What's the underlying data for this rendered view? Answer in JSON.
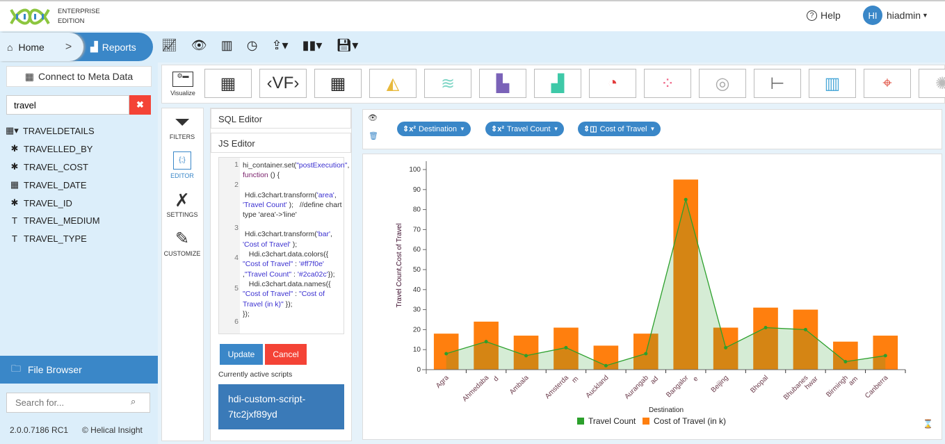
{
  "header": {
    "edition_line1": "ENTERPRISE",
    "edition_line2": "EDITION",
    "help": "Help",
    "avatar_initials": "HI",
    "username": "hiadmin"
  },
  "nav": {
    "home": "Home",
    "reports": "Reports",
    "toolbar_icons": [
      "line-chart-icon",
      "preview-icon",
      "presentation-icon",
      "history-icon",
      "share-icon",
      "layout-icon",
      "save-icon"
    ]
  },
  "sidebar": {
    "connect_label": "Connect to Meta Data",
    "search_value": "travel",
    "table": "TRAVELDETAILS",
    "fields": [
      {
        "label": "TRAVELLED_BY",
        "icon": "measure-icon"
      },
      {
        "label": "TRAVEL_COST",
        "icon": "measure-icon"
      },
      {
        "label": "TRAVEL_DATE",
        "icon": "calendar-icon"
      },
      {
        "label": "TRAVEL_ID",
        "icon": "measure-icon"
      },
      {
        "label": "TRAVEL_MEDIUM",
        "icon": "text-icon"
      },
      {
        "label": "TRAVEL_TYPE",
        "icon": "text-icon"
      }
    ],
    "file_browser": "File Browser",
    "file_search_placeholder": "Search for...",
    "version": "2.0.0.7186 RC1",
    "copyright": "© Helical Insight"
  },
  "visualize": {
    "label": "Visualize"
  },
  "tools": {
    "filters": "FILTERS",
    "editor": "EDITOR",
    "settings": "SETTINGS",
    "customize": "CUSTOMIZE"
  },
  "editor": {
    "sql_title": "SQL Editor",
    "js_title": "JS Editor",
    "update": "Update",
    "cancel": "Cancel",
    "active_scripts_label": "Currently active scripts",
    "active_script": "hdi-custom-script-7tc2jxf89yd"
  },
  "chips": [
    "Destination",
    "Travel Count",
    "Cost of Travel"
  ],
  "colors": {
    "accent": "#3a87c8",
    "cost": "#ff7f0e",
    "count": "#2ca02c",
    "cancel": "#f44336"
  },
  "chart_data": {
    "type": "bar+area",
    "categories": [
      "Agra",
      "Ahmedabad",
      "Ambala",
      "Amsterdam",
      "Auckland",
      "Aurangabad",
      "Bangalore",
      "Beijing",
      "Bhopal",
      "Bhubaneswar",
      "Birmingham",
      "Canberra"
    ],
    "tick_labels": [
      "Agra",
      "Ahmedaba d",
      "Ambala",
      "Amsterda m",
      "Auckland",
      "Aurangab ad",
      "Bangalor e",
      "Beijing",
      "Bhopal",
      "Bhubanes hwar",
      "Birmingh am",
      "Canberra"
    ],
    "series": [
      {
        "name": "Travel Count",
        "type": "area",
        "color": "#2ca02c",
        "values": [
          8,
          14,
          7,
          11,
          2,
          8,
          85,
          11,
          21,
          20,
          4,
          7
        ]
      },
      {
        "name": "Cost of Travel (in k)",
        "type": "bar",
        "color": "#ff7f0e",
        "values": [
          18,
          24,
          17,
          21,
          12,
          18,
          95,
          21,
          31,
          30,
          14,
          17
        ]
      }
    ],
    "xlabel": "Destination",
    "ylabel": "Travel Count,Cost of Travel",
    "ylim": [
      0,
      100
    ],
    "yticks": [
      0,
      10,
      20,
      30,
      40,
      50,
      60,
      70,
      80,
      90,
      100
    ],
    "legend": "bottom",
    "grid": false
  }
}
